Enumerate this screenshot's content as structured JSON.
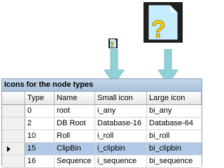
{
  "grid": {
    "caption": "Icons for the node types",
    "columns": [
      "Type",
      "Name",
      "Small icon",
      "Large icon"
    ],
    "rows": [
      {
        "type": "0",
        "name": "root",
        "small": "i_any",
        "large": "bi_any"
      },
      {
        "type": "2",
        "name": "DB Root",
        "small": "Database-16",
        "large": "Database-64"
      },
      {
        "type": "10",
        "name": "Roll",
        "small": "i_roll",
        "large": "bi_roll"
      },
      {
        "type": "15",
        "name": "ClipBin",
        "small": "i_clipbin",
        "large": "bi_clipbin"
      },
      {
        "type": "16",
        "name": "Sequence",
        "small": "i_sequence",
        "large": "bi_sequence"
      }
    ],
    "selected_row_index": 3
  },
  "icons": {
    "large_file": "question-file-icon",
    "small_file": "question-file-icon",
    "arrow": "down-arrow-icon"
  },
  "colors": {
    "icon_fill": "#c6ecff",
    "question": "#ffd400",
    "arrow": "#7ec9cf",
    "caption": "#b7cbe3",
    "selected": "#b1c9e6"
  }
}
